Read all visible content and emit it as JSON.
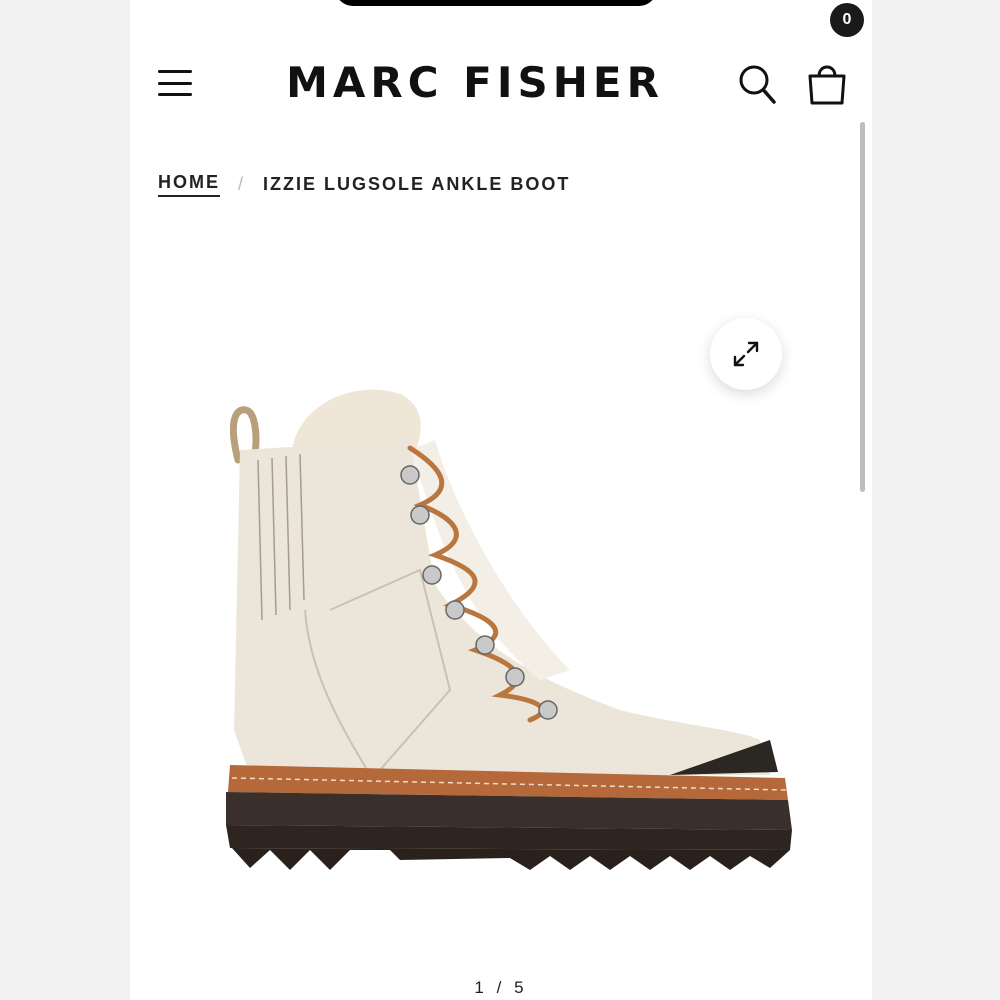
{
  "header": {
    "brand": "MARC FISHER",
    "cart_count": "0"
  },
  "breadcrumb": {
    "home": "HOME",
    "separator": "/",
    "current": "IZZIE LUGSOLE ANKLE BOOT"
  },
  "gallery": {
    "current": "1",
    "separator": "/",
    "total": "5"
  },
  "icons": {
    "menu": "hamburger-icon",
    "search": "search-icon",
    "cart": "shopping-bag-icon",
    "expand": "expand-icon"
  },
  "colors": {
    "background": "#ffffff",
    "text": "#111111",
    "badge": "#1a1a1a"
  }
}
